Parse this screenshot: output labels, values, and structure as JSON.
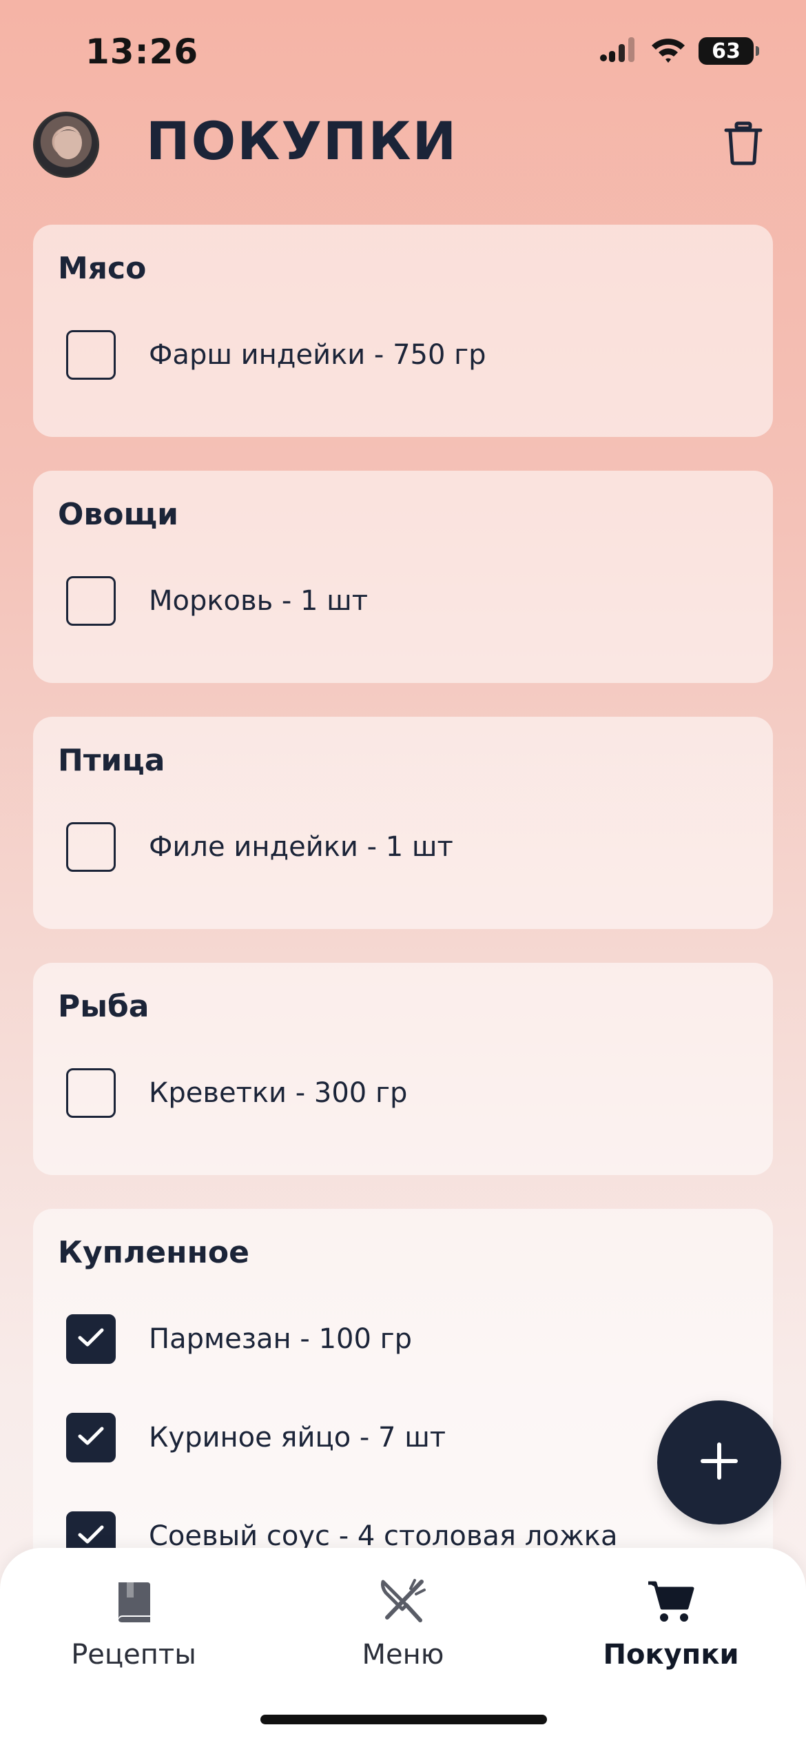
{
  "status_bar": {
    "time": "13:26",
    "battery": "63"
  },
  "header": {
    "title": "ПОКУПКИ"
  },
  "categories": [
    {
      "title": "Мясо",
      "items": [
        {
          "label": "Фарш индейки - 750 гр",
          "checked": false
        }
      ]
    },
    {
      "title": "Овощи",
      "items": [
        {
          "label": "Морковь - 1 шт",
          "checked": false
        }
      ]
    },
    {
      "title": "Птица",
      "items": [
        {
          "label": "Филе индейки - 1 шт",
          "checked": false
        }
      ]
    },
    {
      "title": "Рыба",
      "items": [
        {
          "label": "Креветки - 300 гр",
          "checked": false
        }
      ]
    },
    {
      "title": "Купленное",
      "items": [
        {
          "label": "Пармезан - 100 гр",
          "checked": true
        },
        {
          "label": "Куриное яйцо - 7 шт",
          "checked": true
        },
        {
          "label": "Соевый соус - 4 столовая ложка",
          "checked": true
        }
      ]
    }
  ],
  "tabbar": {
    "tabs": [
      {
        "label": "Рецепты",
        "icon": "book-icon",
        "active": false
      },
      {
        "label": "Меню",
        "icon": "fork-knife-icon",
        "active": false
      },
      {
        "label": "Покупки",
        "icon": "cart-icon",
        "active": true
      }
    ]
  },
  "colors": {
    "accent": "#1b2438",
    "background_top": "#f5b4a6",
    "card": "#fbe4df"
  }
}
